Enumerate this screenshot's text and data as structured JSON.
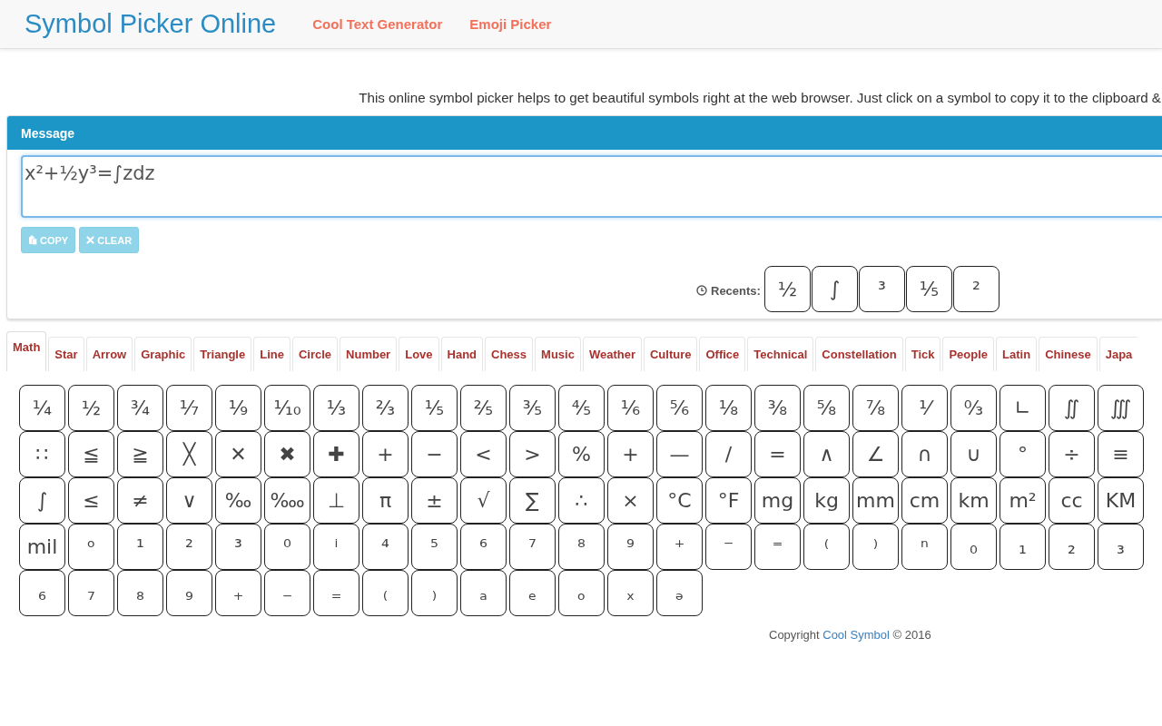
{
  "header": {
    "title": "Symbol Picker Online",
    "links": [
      {
        "label": "Cool Text Generator"
      },
      {
        "label": "Emoji Picker"
      }
    ]
  },
  "intro": "This online symbol picker helps to get beautiful symbols right at the web browser. Just click on a symbol to copy it to the clipboard &",
  "message_panel": {
    "heading": "Message",
    "value": "x²+½y³=∫zdz",
    "buttons": [
      {
        "label": "COPY",
        "kind": "copy",
        "disabled": true
      },
      {
        "label": "CLEAR",
        "kind": "clear",
        "disabled": true
      }
    ],
    "recents_label": "Recents:",
    "recents": [
      "½",
      "∫",
      "³",
      "⅕",
      "²"
    ]
  },
  "tabs": [
    {
      "label": "Math",
      "selected": true
    },
    {
      "label": "Star",
      "selected": false
    },
    {
      "label": "Arrow",
      "selected": false
    },
    {
      "label": "Graphic",
      "selected": false
    },
    {
      "label": "Triangle",
      "selected": false
    },
    {
      "label": "Line",
      "selected": false
    },
    {
      "label": "Circle",
      "selected": false
    },
    {
      "label": "Number",
      "selected": false
    },
    {
      "label": "Love",
      "selected": false
    },
    {
      "label": "Hand",
      "selected": false
    },
    {
      "label": "Chess",
      "selected": false
    },
    {
      "label": "Music",
      "selected": false
    },
    {
      "label": "Weather",
      "selected": false
    },
    {
      "label": "Culture",
      "selected": false
    },
    {
      "label": "Office",
      "selected": false
    },
    {
      "label": "Technical",
      "selected": false
    },
    {
      "label": "Constellation",
      "selected": false
    },
    {
      "label": "Tick",
      "selected": false
    },
    {
      "label": "People",
      "selected": false
    },
    {
      "label": "Latin",
      "selected": false
    },
    {
      "label": "Chinese",
      "selected": false
    },
    {
      "label": "Japa",
      "selected": false
    }
  ],
  "symbols": [
    "¼",
    "½",
    "¾",
    "⅐",
    "⅑",
    "⅒",
    "⅓",
    "⅔",
    "⅕",
    "⅖",
    "⅗",
    "⅘",
    "⅙",
    "⅚",
    "⅛",
    "⅜",
    "⅝",
    "⅞",
    "⅟",
    "↉",
    "∟",
    "∬",
    "∭",
    "∷",
    "≦",
    "≧",
    "╳",
    "✕",
    "✖",
    "✚",
    "+",
    "−",
    "<",
    ">",
    "%",
    "+",
    "—",
    "/",
    "=",
    "∧",
    "∠",
    "∩",
    "∪",
    "°",
    "÷",
    "≡",
    "∫",
    "≤",
    "≠",
    "∨",
    "‰",
    "‱",
    "⊥",
    "π",
    "±",
    "√",
    "∑",
    "∴",
    "×",
    "°C",
    "°F",
    "mg",
    "kg",
    "mm",
    "cm",
    "km",
    "m²",
    "cc",
    "KM",
    "mil",
    "ᵒ",
    "¹",
    "²",
    "³",
    "⁰",
    "ⁱ",
    "⁴",
    "⁵",
    "⁶",
    "⁷",
    "⁸",
    "⁹",
    "⁺",
    "⁻",
    "⁼",
    "⁽",
    "⁾",
    "ⁿ",
    "₀",
    "₁",
    "₂",
    "₃",
    "₆",
    "₇",
    "₈",
    "₉",
    "₊",
    "₋",
    "₌",
    "₍",
    "₎",
    "ₐ",
    "ₑ",
    "ₒ",
    "ₓ",
    "ₔ"
  ],
  "footer": {
    "prefix": "Copyright",
    "link": "Cool Symbol",
    "suffix": "© 2016"
  }
}
